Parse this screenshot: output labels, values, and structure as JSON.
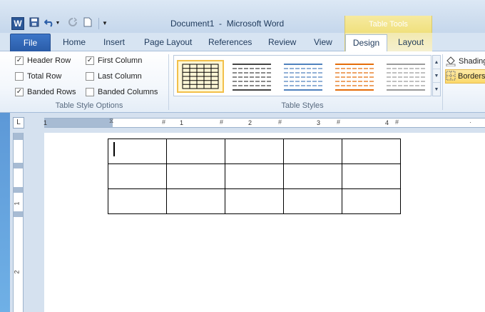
{
  "window": {
    "app_icon": "word-icon",
    "document_title": "Document1  -  Microsoft Word",
    "context_group": "Table Tools"
  },
  "quick_access": [
    "save-icon",
    "undo-icon",
    "redo-icon",
    "new-document-icon",
    "customize-qat-icon"
  ],
  "tabs": {
    "file": "File",
    "items": [
      "Home",
      "Insert",
      "Page Layout",
      "References",
      "Review",
      "View"
    ],
    "context": [
      "Design",
      "Layout"
    ],
    "active": "Design"
  },
  "table_style_options": {
    "group_label": "Table Style Options",
    "options": [
      {
        "label": "Header Row",
        "checked": true
      },
      {
        "label": "Total Row",
        "checked": false
      },
      {
        "label": "Banded Rows",
        "checked": true
      },
      {
        "label": "First Column",
        "checked": true
      },
      {
        "label": "Last Column",
        "checked": false
      },
      {
        "label": "Banded Columns",
        "checked": false
      }
    ]
  },
  "table_styles": {
    "group_label": "Table Styles",
    "styles": [
      {
        "name": "table-grid",
        "color": "#000000",
        "selected": true
      },
      {
        "name": "plain-table-dark",
        "color": "#444444",
        "selected": false
      },
      {
        "name": "light-shading-accent-1",
        "color": "#4f81bd",
        "selected": false
      },
      {
        "name": "light-shading-accent-2",
        "color": "#e46c0a",
        "selected": false
      },
      {
        "name": "light-shading-accent-3",
        "color": "#9a9a9a",
        "selected": false
      }
    ]
  },
  "shading_borders": {
    "shading": "Shading",
    "borders": "Borders"
  },
  "rulers": {
    "corner_glyph": "L",
    "h_numbers": [
      "1",
      "1",
      "2",
      "3",
      "4"
    ],
    "v_numbers": [
      "1",
      "2"
    ]
  },
  "document_table": {
    "rows": 3,
    "cols": 5
  }
}
